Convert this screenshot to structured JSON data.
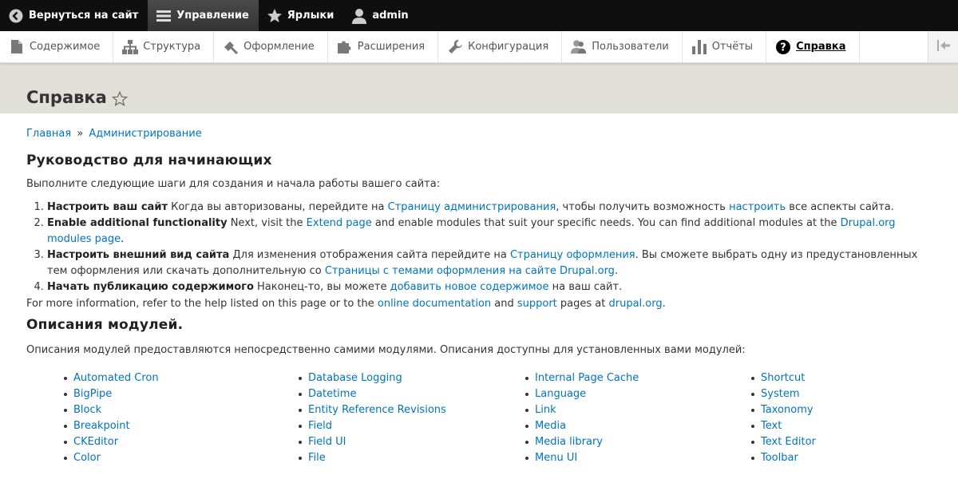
{
  "toolbar": {
    "back_label": "Вернуться на сайт",
    "manage_label": "Управление",
    "shortcuts_label": "Ярлыки",
    "user_label": "admin"
  },
  "tray": {
    "items": [
      {
        "label": "Содержимое",
        "icon": "file-icon"
      },
      {
        "label": "Структура",
        "icon": "sitemap-icon"
      },
      {
        "label": "Оформление",
        "icon": "brush-icon"
      },
      {
        "label": "Расширения",
        "icon": "puzzle-icon"
      },
      {
        "label": "Конфигурация",
        "icon": "wrench-icon"
      },
      {
        "label": "Пользователи",
        "icon": "people-icon"
      },
      {
        "label": "Отчёты",
        "icon": "bar-chart-icon"
      },
      {
        "label": "Справка",
        "icon": "help-icon"
      }
    ]
  },
  "page": {
    "title": "Справка"
  },
  "breadcrumb": {
    "home": "Главная",
    "sep": "»",
    "admin": "Администрирование"
  },
  "getting_started": {
    "heading": "Руководство для начинающих",
    "intro": "Выполните следующие шаги для создания и начала работы вашего сайта:",
    "step1": {
      "title": "Настроить ваш сайт",
      "t1": " Когда вы авторизованы, перейдите на ",
      "link1": "Страницу администрирования",
      "t2": ", чтобы получить возможность ",
      "link2": "настроить",
      "t3": " все аспекты сайта."
    },
    "step2": {
      "title": "Enable additional functionality",
      "t1": " Next, visit the ",
      "link1": "Extend page",
      "t2": " and enable modules that suit your specific needs. You can find additional modules at the ",
      "link2": "Drupal.org modules page",
      "t3": "."
    },
    "step3": {
      "title": "Настроить внешний вид сайта",
      "t1": " Для изменения отображения сайта перейдите на ",
      "link1": "Страницу оформления",
      "t2": ". Вы сможете выбрать одну из предустановленных тем оформления или скачать дополнительную со ",
      "link2": "Страницы с темами оформления на сайте Drupal.org",
      "t3": "."
    },
    "step4": {
      "title": "Начать публикацию содержимого",
      "t1": " Наконец-то, вы можете ",
      "link1": "добавить новое содержимое",
      "t2": " на ваш сайт."
    },
    "more": {
      "t1": "For more information, refer to the help listed on this page or to the ",
      "link1": "online documentation",
      "t2": " and ",
      "link2": "support",
      "t3": " pages at ",
      "link3": "drupal.org",
      "t4": "."
    }
  },
  "modules": {
    "heading": "Описания модулей.",
    "intro": "Описания модулей предоставляются непосредственно самими модулями. Описания доступны для установленных вами модулей:",
    "col1": [
      "Automated Cron",
      "BigPipe",
      "Block",
      "Breakpoint",
      "CKEditor",
      "Color"
    ],
    "col2": [
      "Database Logging",
      "Datetime",
      "Entity Reference Revisions",
      "Field",
      "Field UI",
      "File"
    ],
    "col3": [
      "Internal Page Cache",
      "Language",
      "Link",
      "Media",
      "Media library",
      "Menu UI"
    ],
    "col4": [
      "Shortcut",
      "System",
      "Taxonomy",
      "Text",
      "Text Editor",
      "Toolbar"
    ]
  },
  "colors": {
    "link": "#0074bd",
    "toolbar_bg": "#0f0f0f",
    "header_bg": "#e0e0d8"
  }
}
